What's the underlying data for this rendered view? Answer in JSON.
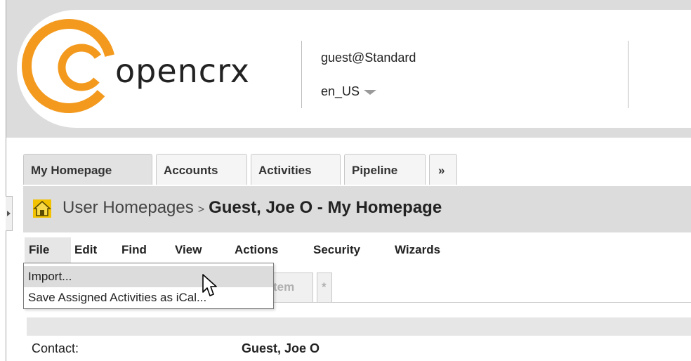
{
  "header": {
    "logo_text": "opencrx",
    "user": "guest@Standard",
    "locale": "en_US",
    "accent_color": "#f39a1e"
  },
  "tabs": [
    {
      "label": "My Homepage",
      "active": true
    },
    {
      "label": "Accounts"
    },
    {
      "label": "Activities"
    },
    {
      "label": "Pipeline"
    },
    {
      "label": "»"
    }
  ],
  "titlebar": {
    "crumb": "User Homepages",
    "separator": ">",
    "title": "Guest, Joe O - My Homepage"
  },
  "menubar": {
    "items": [
      "File",
      "Edit",
      "Find",
      "View",
      "Actions",
      "Security",
      "Wizards"
    ]
  },
  "file_menu": {
    "items": [
      "Import...",
      "Save Assigned Activities as iCal..."
    ]
  },
  "subtabs": [
    "tem",
    "*"
  ],
  "detail": {
    "contact_label": "Contact:",
    "contact_value": "Guest, Joe O"
  }
}
